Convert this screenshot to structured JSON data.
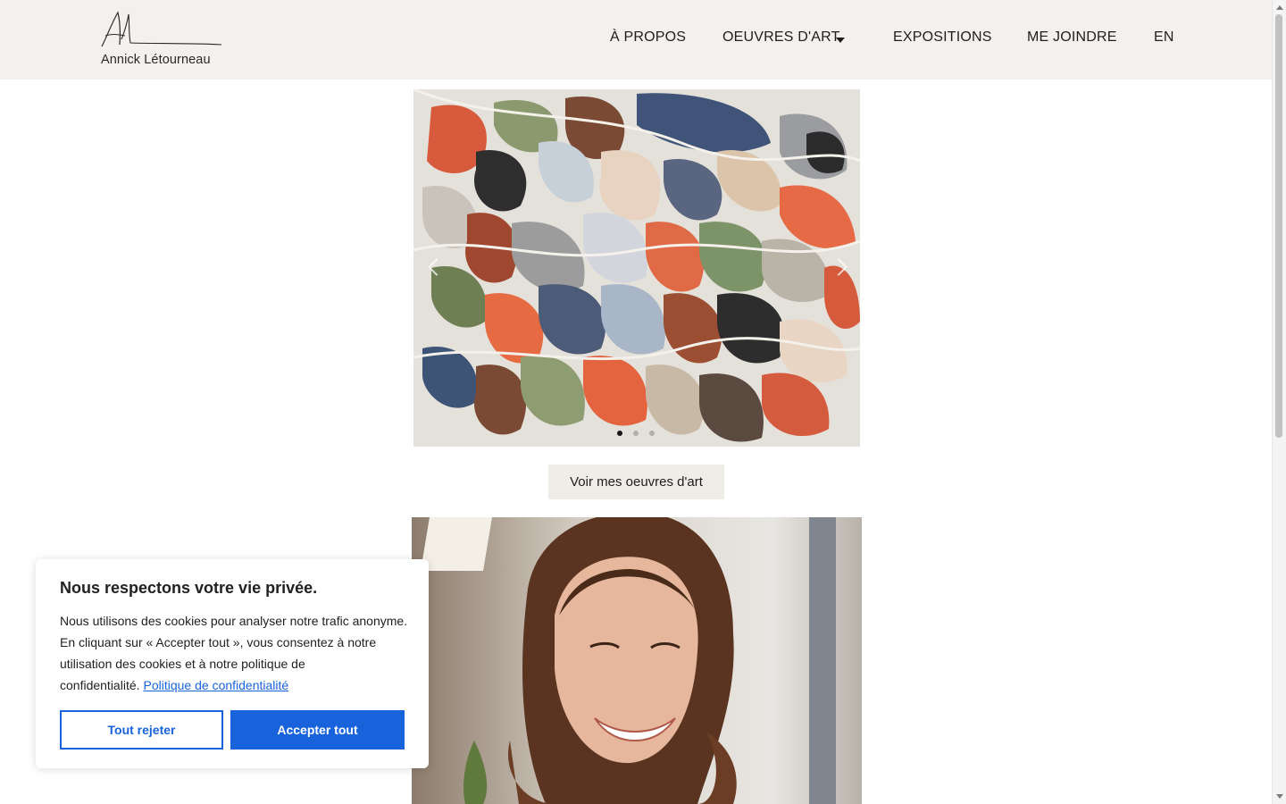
{
  "brand": {
    "name": "Annick Létourneau",
    "signature_icon": "signature-logo"
  },
  "nav": {
    "items": [
      {
        "label": "À PROPOS"
      },
      {
        "label": "OEUVRES D'ART",
        "has_dropdown": true,
        "dropdown_icon": "caret-down-icon"
      },
      {
        "label": "EXPOSITIONS"
      },
      {
        "label": "ME JOINDRE"
      },
      {
        "label": "EN"
      }
    ]
  },
  "slider": {
    "image": "abstract-painting",
    "total_slides": 3,
    "active_slide": 1,
    "prev_icon": "chevron-left-icon",
    "next_icon": "chevron-right-icon"
  },
  "cta": {
    "label": "Voir mes oeuvres d'art"
  },
  "portrait": {
    "image": "artist-portrait-photo"
  },
  "cookie": {
    "title": "Nous respectons votre vie privée.",
    "text": "Nous utilisons des cookies pour analyser notre trafic anonyme. En cliquant sur « Accepter tout », vous consentez à notre utilisation des cookies et à notre politique de confidentialité.",
    "link_label": "Politique de confidentialité",
    "reject_label": "Tout rejeter",
    "accept_label": "Accepter tout"
  },
  "colors": {
    "header_bg": "#f3f0ed",
    "button_bg": "#f0ece8",
    "cookie_accent": "#1863dc"
  }
}
